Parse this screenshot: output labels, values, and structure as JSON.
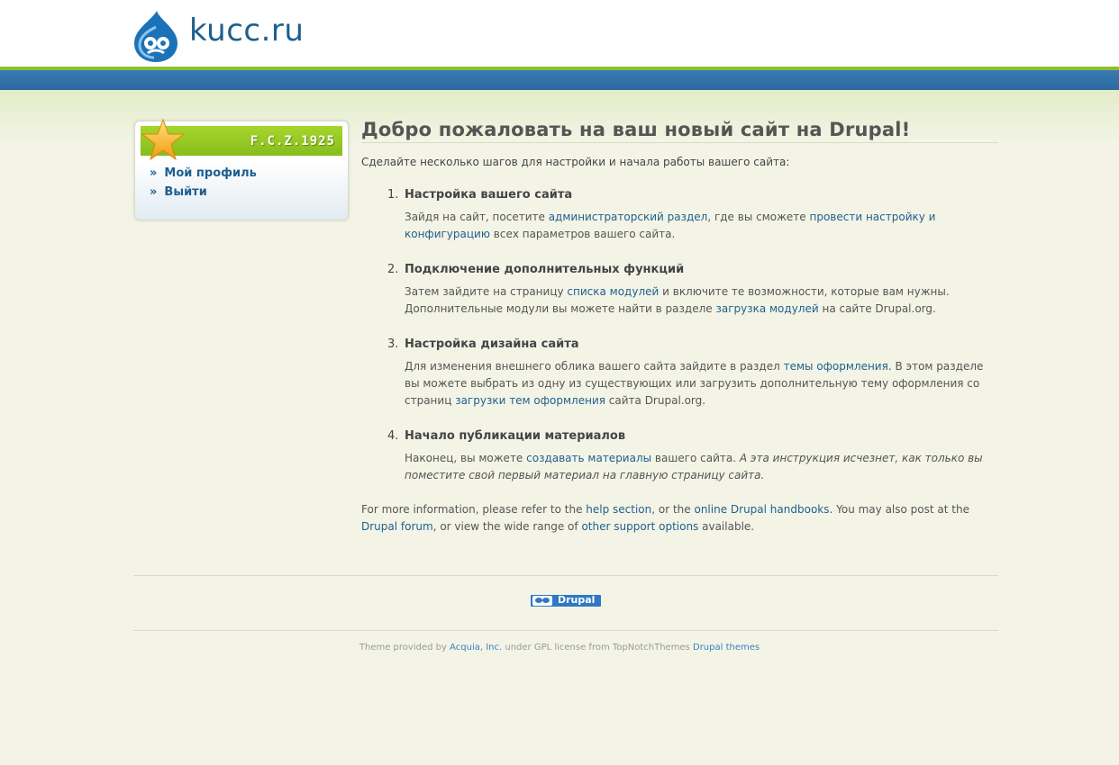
{
  "site": {
    "name": "kucc.ru"
  },
  "colors": {
    "brand_blue": "#1d5f8e",
    "green": "#8cbf2b",
    "bar_blue": "#2b6aa0"
  },
  "user_block": {
    "title": "F.C.Z.1925",
    "items": [
      {
        "label": "Мой профиль",
        "icon": "double-chevron-right-icon"
      },
      {
        "label": "Выйти",
        "icon": "double-chevron-right-icon"
      }
    ]
  },
  "main": {
    "heading": "Добро пожаловать на ваш новый сайт на Drupal!",
    "intro": "Сделайте несколько шагов для настройки и начала работы вашего сайта:",
    "steps": [
      {
        "num": "1.",
        "title": "Настройка вашего сайта",
        "t1": "Зайдя на сайт, посетите ",
        "l1": "администраторский раздел",
        "t2": ", где вы сможете ",
        "l2": "провести настройку и конфигурацию",
        "t3": " всех параметров вашего сайта."
      },
      {
        "num": "2.",
        "title": "Подключение дополнительных функций",
        "t1": "Затем зайдите на страницу ",
        "l1": "списка модулей",
        "t2": " и включите те возможности, которые вам нужны. Дополнительные модули вы можете найти в разделе ",
        "l2": "загрузка модулей",
        "t3": " на сайте Drupal.org."
      },
      {
        "num": "3.",
        "title": "Настройка дизайна сайта",
        "t1": "Для изменения внешнего облика вашего сайта зайдите в раздел ",
        "l1": "темы оформления",
        "t2": ". В этом разделе вы можете выбрать из одну из существующих или загрузить дополнительную тему оформления со страниц ",
        "l2": "загрузки тем оформления",
        "t3": " сайта Drupal.org."
      },
      {
        "num": "4.",
        "title": "Начало публикации материалов",
        "t1": "Наконец, вы можете ",
        "l1": "создавать материалы",
        "t2": " вашего сайта. ",
        "em": "А эта инструкция исчезнет, как только вы поместите свой первый материал на главную страницу сайта."
      }
    ],
    "more": {
      "t1": "For more information, please refer to the ",
      "l1": "help section",
      "t2": ", or the ",
      "l2": "online Drupal handbooks",
      "t3": ". You may also post at the ",
      "l3": "Drupal forum",
      "t4": ", or view the wide range of ",
      "l4": "other support options",
      "t5": " available."
    }
  },
  "footer": {
    "badge": "Drupal",
    "c1": "Theme provided by ",
    "c_l1": "Acquia, Inc.",
    "c2": " under GPL license from TopNotchThemes ",
    "c_l2": "Drupal themes"
  }
}
